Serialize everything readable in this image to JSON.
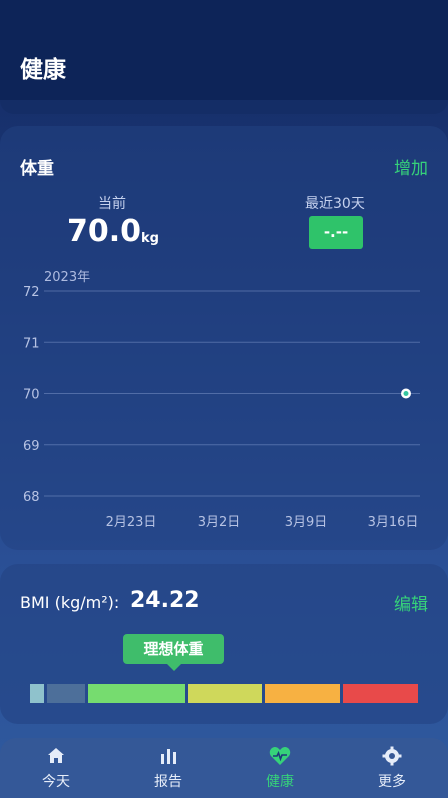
{
  "header": {
    "title": "健康"
  },
  "weight": {
    "title": "体重",
    "add_label": "增加",
    "current_label": "当前",
    "current_value": "70.0",
    "current_unit": "kg",
    "recent_label": "最近30天",
    "recent_value": "-.--"
  },
  "chart_data": {
    "type": "line",
    "title": "",
    "year_label": "2023年",
    "y_ticks": [
      "72",
      "71",
      "70",
      "69",
      "68"
    ],
    "ylim": [
      68,
      72
    ],
    "x_ticks": [
      "2月23日",
      "3月2日",
      "3月9日",
      "3月16日"
    ],
    "series": [
      {
        "x": [
          "3月18日"
        ],
        "values": [
          70.0
        ]
      }
    ],
    "grid": true
  },
  "bmi": {
    "label": "BMI (kg/m²):",
    "value": "24.22",
    "edit_label": "编辑",
    "tooltip": "理想体重",
    "segment_colors": [
      "#8fc2cc",
      "#4d6f9a",
      "#76dc6f",
      "#cfd85b",
      "#f7b142",
      "#e84a4a"
    ]
  },
  "nav": {
    "items": [
      {
        "label": "今天",
        "icon": "home-icon"
      },
      {
        "label": "报告",
        "icon": "bar-chart-icon"
      },
      {
        "label": "健康",
        "icon": "heart-pulse-icon"
      },
      {
        "label": "更多",
        "icon": "gear-icon"
      }
    ],
    "active_color": "#36d27a"
  }
}
